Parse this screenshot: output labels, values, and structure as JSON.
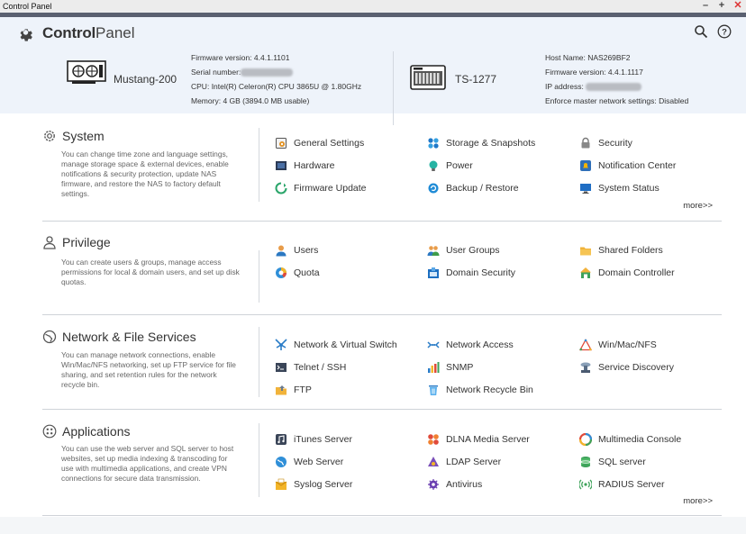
{
  "window": {
    "title": "Control Panel"
  },
  "header": {
    "title_bold": "Control",
    "title_light": "Panel",
    "device1": {
      "name": "Mustang-200",
      "firmware_label": "Firmware version:",
      "firmware": "4.4.1.1101",
      "serial_label": "Serial number:",
      "cpu_label": "CPU:",
      "cpu": "Intel(R) Celeron(R) CPU 3865U @ 1.80GHz",
      "memory_label": "Memory:",
      "memory": "4 GB (3894.0 MB usable)"
    },
    "device2": {
      "name": "TS-1277",
      "host_label": "Host Name:",
      "host": "NAS269BF2",
      "firmware_label": "Firmware version:",
      "firmware": "4.4.1.1117",
      "ip_label": "IP address:",
      "enforce_label": "Enforce master network settings:",
      "enforce": "Disabled"
    }
  },
  "sections": {
    "system": {
      "title": "System",
      "desc": "You can change time zone and language settings, manage storage space & external devices, enable notifications & security protection, update NAS firmware, and restore the NAS to factory default settings.",
      "items": [
        "General Settings",
        "Storage & Snapshots",
        "Security",
        "Hardware",
        "Power",
        "Notification Center",
        "Firmware Update",
        "Backup / Restore",
        "System Status"
      ],
      "more": "more>>"
    },
    "privilege": {
      "title": "Privilege",
      "desc": "You can create users & groups, manage access permissions for local & domain users, and set up disk quotas.",
      "items": [
        "Users",
        "User Groups",
        "Shared Folders",
        "Quota",
        "Domain Security",
        "Domain Controller"
      ]
    },
    "network": {
      "title": "Network & File Services",
      "desc": "You can manage network connections, enable Win/Mac/NFS networking, set up FTP service for file sharing, and set retention rules for the network recycle bin.",
      "items": [
        "Network & Virtual Switch",
        "Network Access",
        "Win/Mac/NFS",
        "Telnet / SSH",
        "SNMP",
        "Service Discovery",
        "FTP",
        "Network Recycle Bin"
      ]
    },
    "applications": {
      "title": "Applications",
      "desc": "You can use the web server and SQL server to host websites, set up media indexing & transcoding for use with multimedia applications, and create VPN connections for secure data transmission.",
      "items": [
        "iTunes Server",
        "DLNA Media Server",
        "Multimedia Console",
        "Web Server",
        "LDAP Server",
        "SQL server",
        "Syslog Server",
        "Antivirus",
        "RADIUS Server"
      ],
      "more": "more>>"
    }
  }
}
